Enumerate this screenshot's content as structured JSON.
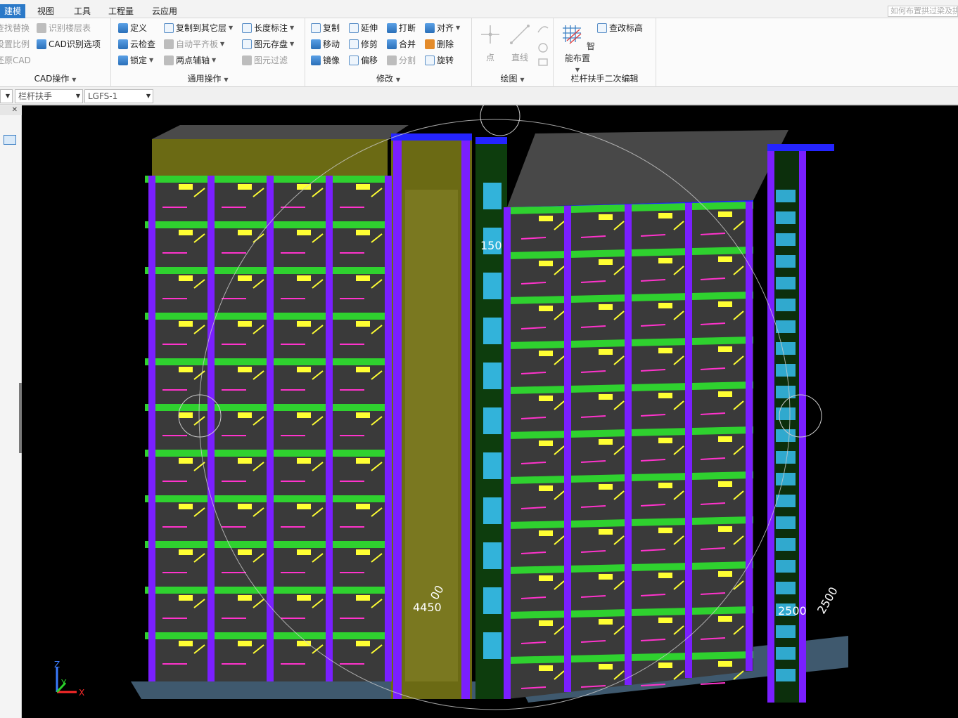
{
  "menu": {
    "tabs": [
      {
        "label": "建模",
        "active": true
      },
      {
        "label": "视图",
        "active": false
      },
      {
        "label": "工具",
        "active": false
      },
      {
        "label": "工程量",
        "active": false
      },
      {
        "label": "云应用",
        "active": false
      }
    ],
    "help_placeholder": "如何布置拱过梁及拱"
  },
  "ribbon": {
    "cad": {
      "title": "CAD操作",
      "items": [
        "查找替换",
        "识别楼层表",
        "设置比例",
        "CAD识别选项",
        "还原CAD"
      ]
    },
    "common": {
      "title": "通用操作",
      "items": [
        "定义",
        "复制到其它层",
        "长度标注",
        "云检查",
        "自动平齐板",
        "图元存盘",
        "锁定",
        "两点辅轴",
        "图元过滤"
      ]
    },
    "modify": {
      "title": "修改",
      "items": [
        "复制",
        "延伸",
        "打断",
        "对齐",
        "移动",
        "修剪",
        "合并",
        "删除",
        "镜像",
        "偏移",
        "分割",
        "旋转"
      ]
    },
    "draw": {
      "title": "绘图",
      "items": [
        "点",
        "直线"
      ]
    },
    "railing": {
      "title": "栏杆扶手二次编辑",
      "items": [
        "智能布置",
        "查改标高"
      ]
    }
  },
  "propbar": {
    "component_type": "栏杆扶手",
    "component_name": "LGFS-1"
  },
  "viewport": {
    "dimension_labels": [
      "150",
      "4450",
      "00",
      "2500",
      "2500"
    ],
    "axes": {
      "x": "X",
      "y": "Y",
      "z": "Z"
    },
    "colors": {
      "background": "#000000",
      "slab": "#3a3a3a",
      "beam": "#2fd12f",
      "column": "#7a1fff",
      "wall": "#6b6a14",
      "rebar": "#ffff33",
      "railing": "#ff33cc",
      "stair": "#39c8ff",
      "gridline": "#cccccc"
    }
  }
}
